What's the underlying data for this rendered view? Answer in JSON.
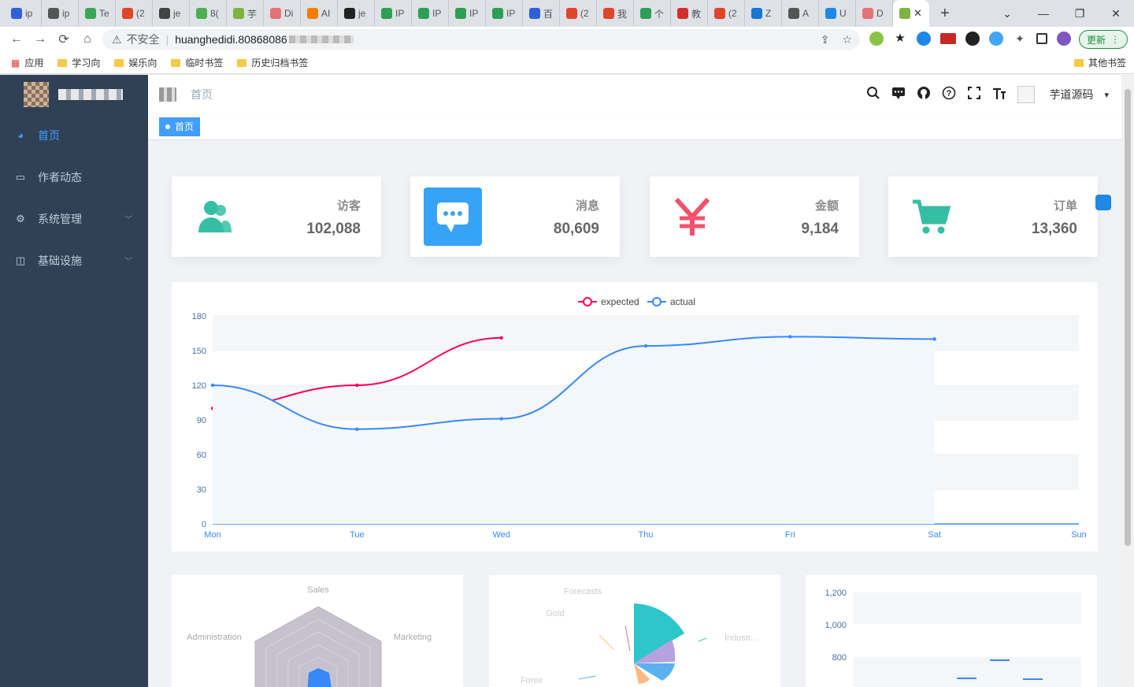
{
  "browser": {
    "tabs": [
      {
        "label": "ip",
        "color": "#3060d8"
      },
      {
        "label": "ip",
        "color": "#555555"
      },
      {
        "label": "Te",
        "color": "#3aa757"
      },
      {
        "label": "(2",
        "color": "#e0452b"
      },
      {
        "label": "je",
        "color": "#444444"
      },
      {
        "label": "8(",
        "color": "#4caf50"
      },
      {
        "label": "芋",
        "color": "#7cb342"
      },
      {
        "label": "Di",
        "color": "#e57373"
      },
      {
        "label": "AI",
        "color": "#f57c00"
      },
      {
        "label": "je",
        "color": "#222222"
      },
      {
        "label": "IP",
        "color": "#2e9e55"
      },
      {
        "label": "IP",
        "color": "#2e9e55"
      },
      {
        "label": "IP",
        "color": "#2e9e55"
      },
      {
        "label": "IP",
        "color": "#2e9e55"
      },
      {
        "label": "百",
        "color": "#3060d8"
      },
      {
        "label": "(2",
        "color": "#e0452b"
      },
      {
        "label": "我",
        "color": "#e0452b"
      },
      {
        "label": "个",
        "color": "#2e9e55"
      },
      {
        "label": "教",
        "color": "#d32f2f"
      },
      {
        "label": "(2",
        "color": "#e0452b"
      },
      {
        "label": "Z",
        "color": "#1976d2"
      },
      {
        "label": "A",
        "color": "#555555"
      },
      {
        "label": "U",
        "color": "#1e88e5"
      },
      {
        "label": "D",
        "color": "#e57373"
      }
    ],
    "active_tab_close": "✕",
    "new_tab": "+",
    "window_controls": [
      "⌄",
      "—",
      "❐",
      "✕"
    ],
    "nav": {
      "back": "←",
      "forward": "→",
      "reload": "⟳",
      "home": "⌂"
    },
    "address": {
      "warning_icon": "⚠",
      "insecure_label": "不安全",
      "url": "huanghedidi.80868086"
    },
    "update_label": "更新",
    "bookmarks": [
      "应用",
      "学习向",
      "娱乐向",
      "临时书签",
      "历史归档书签"
    ],
    "other_bookmarks": "其他书签"
  },
  "sidebar": {
    "items": [
      {
        "label": "首页",
        "icon": "dashboard-icon",
        "active": true
      },
      {
        "label": "作者动态",
        "icon": "message-icon"
      },
      {
        "label": "系统管理",
        "icon": "gear-icon",
        "has_children": true
      },
      {
        "label": "基础设施",
        "icon": "monitor-icon",
        "has_children": true
      }
    ]
  },
  "navbar": {
    "breadcrumb": "首页",
    "username": "芋道源码",
    "dropdown": "▾"
  },
  "tags": {
    "active": "首页"
  },
  "stats": [
    {
      "label": "访客",
      "value": "102,088",
      "icon": "peoples-icon",
      "color": "#34bfa3"
    },
    {
      "label": "消息",
      "value": "80,609",
      "icon": "message-icon",
      "color": "#36a3f7"
    },
    {
      "label": "金额",
      "value": "9,184",
      "icon": "money-icon",
      "color": "#f4516c"
    },
    {
      "label": "订单",
      "value": "13,360",
      "icon": "shopping-icon",
      "color": "#34bfa3"
    }
  ],
  "chart_data": [
    {
      "type": "line",
      "categories": [
        "Mon",
        "Tue",
        "Wed",
        "Thu",
        "Fri",
        "Sat",
        "Sun"
      ],
      "series": [
        {
          "name": "expected",
          "values": [
            100,
            120,
            161,
            null,
            null,
            null,
            null
          ],
          "color": "#ff005a"
        },
        {
          "name": "actual",
          "values": [
            120,
            82,
            91,
            154,
            162,
            160,
            null
          ],
          "color": "#3888fa"
        }
      ],
      "ylim": [
        0,
        180
      ],
      "yticks": [
        0,
        30,
        60,
        90,
        120,
        150,
        180
      ],
      "legend": "top-center",
      "grid": true
    },
    {
      "type": "radar",
      "indicators": [
        "Sales",
        "Administration",
        "Marketing"
      ]
    },
    {
      "type": "pie",
      "labels": [
        "Forecasts",
        "Gold",
        "Industr...",
        "Forex"
      ]
    },
    {
      "type": "bar",
      "yticks": [
        "1,200",
        "1,000",
        "800"
      ]
    }
  ]
}
